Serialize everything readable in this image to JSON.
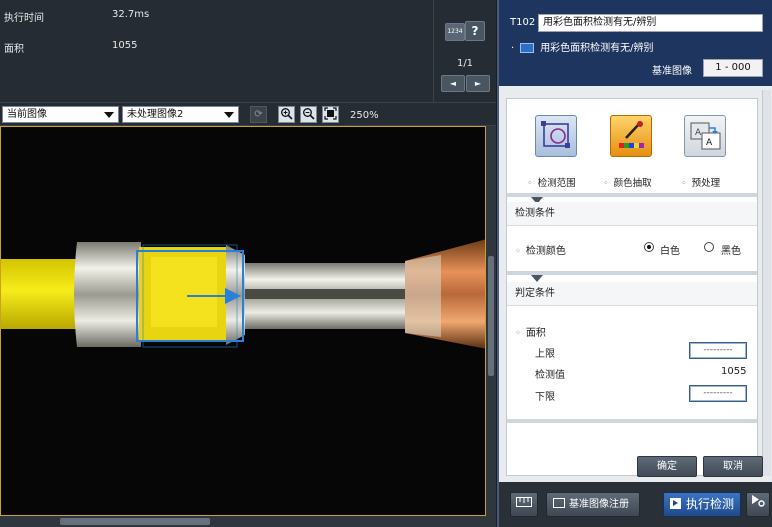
{
  "info": {
    "exec_time_label": "执行时间",
    "exec_time_value": "32.7ms",
    "area_label": "面积",
    "area_value": "1055"
  },
  "nav": {
    "btn_1234": "1234",
    "btn_help": "?",
    "page": "1/1",
    "prev": "◄",
    "next": "►"
  },
  "tool": {
    "id": "T102",
    "name": "用彩色面积检测有无/辨别",
    "subtitle": "用彩色面积检测有无/辨别",
    "ref_image_label": "基准图像",
    "ref_image_value": "1 - 000"
  },
  "toolbar": {
    "view_select": "当前图像",
    "image_select": "未处理图像2",
    "zoom": "250%"
  },
  "actions": {
    "range": "检测范围",
    "color_extract": "颜色抽取",
    "preprocess": "预处理"
  },
  "detect_condition": {
    "title": "检测条件",
    "color_label": "检测颜色",
    "white": "白色",
    "black": "黑色",
    "selected": "white"
  },
  "judge_condition": {
    "title": "判定条件",
    "area_label": "面积",
    "upper_label": "上限",
    "upper_value": "---------",
    "measured_label": "检测值",
    "measured_value": "1055",
    "lower_label": "下限",
    "lower_value": "---------"
  },
  "buttons": {
    "ok": "确定",
    "cancel": "取消",
    "register_ref": "基准图像注册",
    "execute": "执行检测"
  },
  "colors": {
    "header_bg": "#1e3560",
    "accent_blue": "#1f4a8a",
    "roi_blue": "#2a7fd8",
    "viewport_border": "#c8a02a"
  }
}
